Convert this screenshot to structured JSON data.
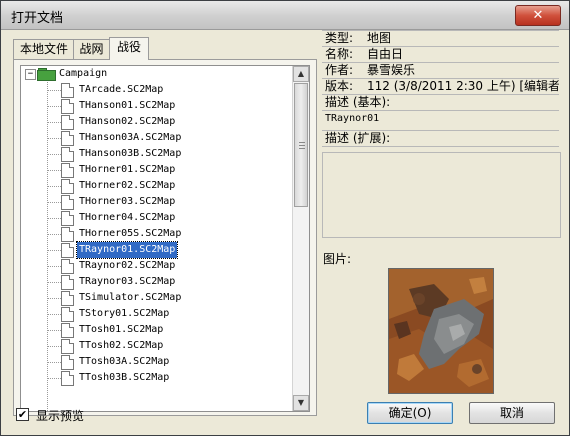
{
  "window": {
    "title": "打开文档",
    "close_label": "✕"
  },
  "tabs": [
    {
      "label": "本地文件",
      "active": false
    },
    {
      "label": "战网",
      "active": false
    },
    {
      "label": "战役",
      "active": true
    }
  ],
  "tree": {
    "root": {
      "label": "Campaign",
      "expander": "−",
      "icon": "folder-icon"
    },
    "files": [
      "TArcade.SC2Map",
      "THanson01.SC2Map",
      "THanson02.SC2Map",
      "THanson03A.SC2Map",
      "THanson03B.SC2Map",
      "THorner01.SC2Map",
      "THorner02.SC2Map",
      "THorner03.SC2Map",
      "THorner04.SC2Map",
      "THorner05S.SC2Map",
      "TRaynor01.SC2Map",
      "TRaynor02.SC2Map",
      "TRaynor03.SC2Map",
      "TSimulator.SC2Map",
      "TStory01.SC2Map",
      "TTosh01.SC2Map",
      "TTosh02.SC2Map",
      "TTosh03A.SC2Map",
      "TTosh03B.SC2Map"
    ],
    "selected": "TRaynor01.SC2Map"
  },
  "properties": [
    {
      "key": "类型:",
      "value": "地图"
    },
    {
      "key": "名称:",
      "value": "自由日"
    },
    {
      "key": "作者:",
      "value": "暴雪娱乐"
    },
    {
      "key": "版本:",
      "value": "112 (3/8/2011 2:30 上午) [编辑者"
    }
  ],
  "description": {
    "basic_label": "描述 (基本):",
    "basic_value": "TRaynor01",
    "extended_label": "描述 (扩展):",
    "extended_value": ""
  },
  "picture_label": "图片:",
  "show_preview": {
    "label": "显示预览",
    "checked": true,
    "check_glyph": "✔"
  },
  "buttons": {
    "ok": "确定(O)",
    "cancel": "取消"
  },
  "colors": {
    "selection": "#316ac5",
    "folder": "#47a13f",
    "close": "#c8432e"
  }
}
